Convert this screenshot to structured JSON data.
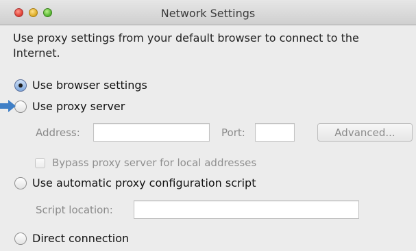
{
  "window": {
    "title": "Network Settings",
    "controls": [
      "close-button",
      "minimize-button",
      "zoom-button"
    ]
  },
  "description": "Use proxy settings from your default browser to connect to the Internet.",
  "options": {
    "browser_settings": {
      "label": "Use browser settings",
      "selected": true
    },
    "proxy_server": {
      "label": "Use proxy server",
      "selected": false
    },
    "auto_proxy": {
      "label": "Use automatic proxy configuration script",
      "selected": false
    },
    "direct": {
      "label": "Direct connection",
      "selected": false
    }
  },
  "proxy": {
    "address_label": "Address:",
    "address_value": "",
    "port_label": "Port:",
    "port_value": "",
    "advanced_label": "Advanced...",
    "bypass_label": "Bypass proxy server for local addresses",
    "bypass_checked": false
  },
  "script": {
    "location_label": "Script location:",
    "location_value": ""
  },
  "annotation": {
    "arrow_color": "#3f7fc6",
    "target": "Use proxy server"
  },
  "colors": {
    "background": "#ececec",
    "radio_selected": "#7fa7dc",
    "disabled_text": "#8a8a8a"
  }
}
